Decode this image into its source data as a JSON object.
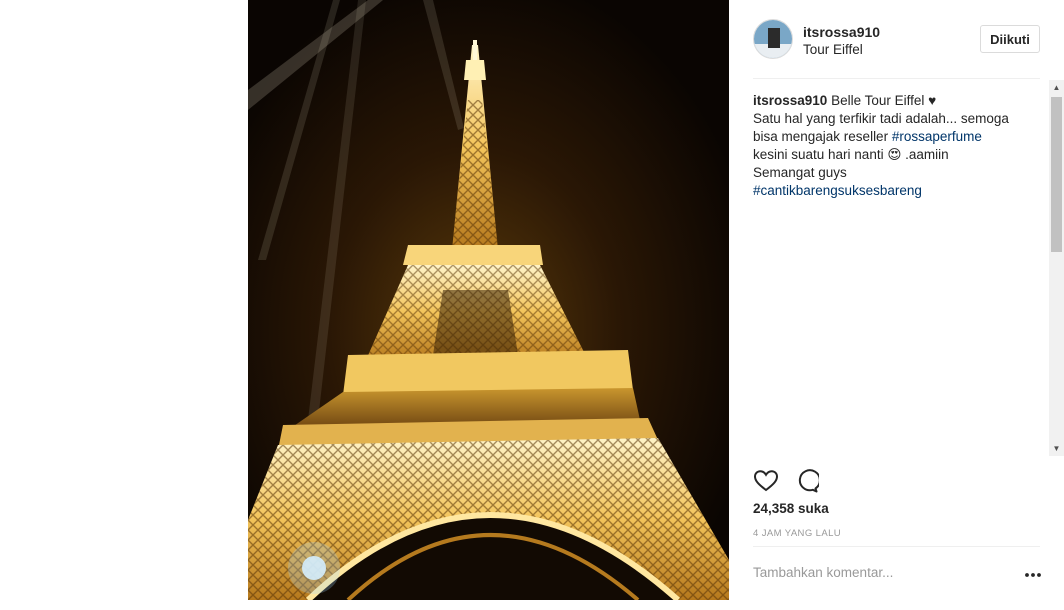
{
  "post": {
    "username": "itsrossa910",
    "location": "Tour Eiffel",
    "follow_label": "Diikuti",
    "caption": {
      "username": "itsrossa910",
      "line1": " Belle Tour Eiffel ♥",
      "line2": "Satu hal yang terfikir tadi adalah... semoga",
      "line3": "bisa mengajak reseller ",
      "hashtag1": "#rossaperfume",
      "line4": "kesini suatu hari nanti 😍 .aamiin",
      "line5": "Semangat guys",
      "hashtag2": "#cantikbarengsuksesbareng"
    },
    "likes": "24,358 suka",
    "time_ago": "4 JAM YANG LALU",
    "comment_placeholder": "Tambahkan komentar..."
  },
  "icons": {
    "like": "heart-icon",
    "comment": "comment-bubble-icon",
    "more": "more-options-icon"
  },
  "colors": {
    "hashtag": "#003569",
    "text": "#262626",
    "muted": "#999999"
  }
}
